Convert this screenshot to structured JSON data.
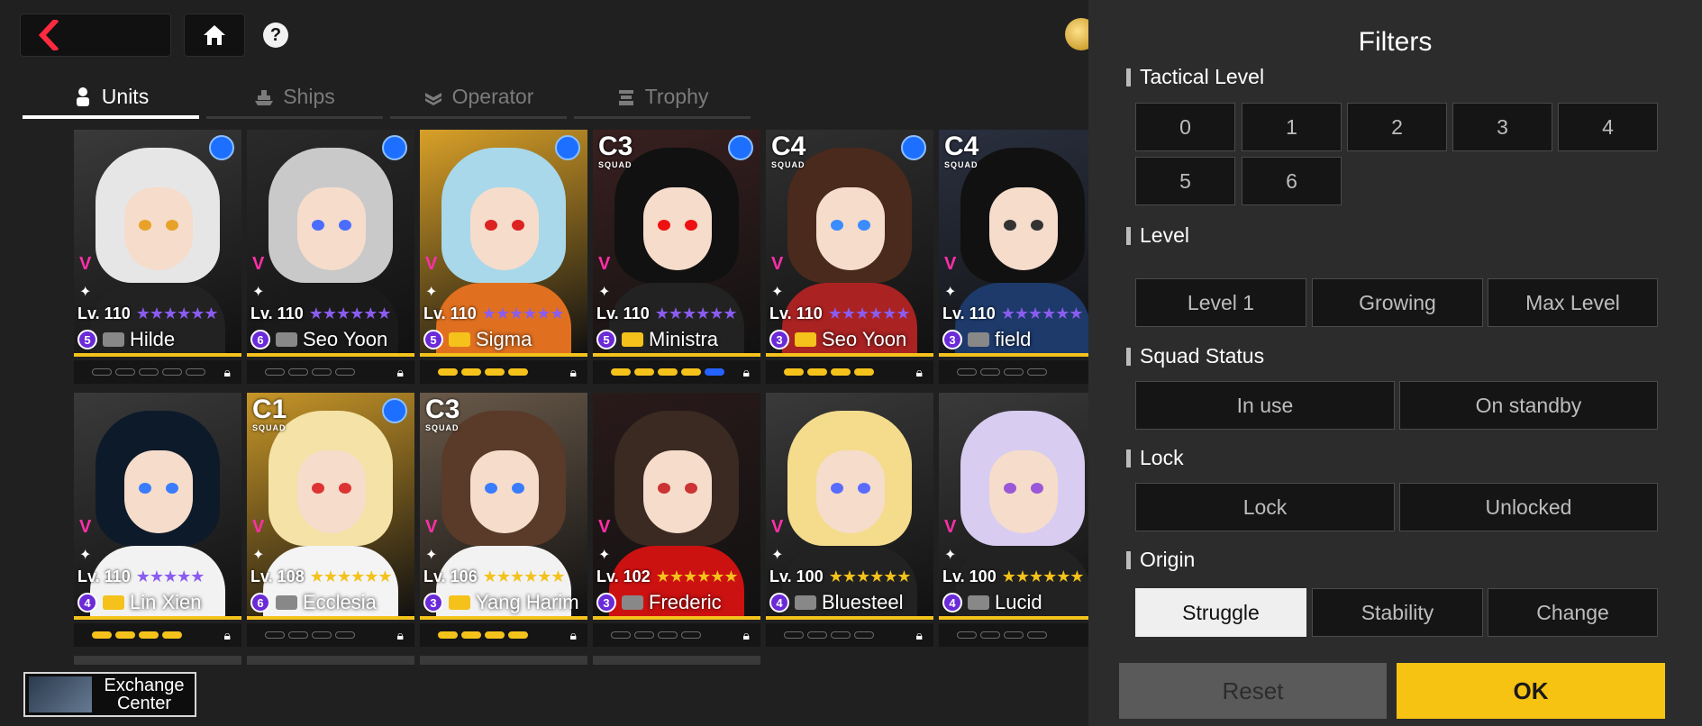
{
  "nav": {
    "back_icon": "back-arrow-icon",
    "home_icon": "home-icon",
    "help_label": "?"
  },
  "tabs": [
    {
      "label": "Units",
      "active": true,
      "icon": "person-icon"
    },
    {
      "label": "Ships",
      "active": false,
      "icon": "ship-icon"
    },
    {
      "label": "Operator",
      "active": false,
      "icon": "operator-icon"
    },
    {
      "label": "Trophy",
      "active": false,
      "icon": "trophy-icon"
    }
  ],
  "units": [
    {
      "name": "Hilde",
      "level": "Lv. 110",
      "rank": "5",
      "class": "",
      "squad": "",
      "stars": "★★★★★★",
      "pips": [
        0,
        0,
        0,
        0,
        0
      ],
      "hair": "#e6e6e6",
      "eyes": "#e8a22a",
      "outfit": "#222",
      "bg": "#3a3a3a"
    },
    {
      "name": "Seo Yoon",
      "level": "Lv. 110",
      "rank": "6",
      "class": "",
      "squad": "",
      "stars": "★★★★★★",
      "pips": [
        0,
        0,
        0,
        0
      ],
      "hair": "#c9c9c9",
      "eyes": "#4a6cff",
      "outfit": "#1a1a1a",
      "bg": "#2a2a2a"
    },
    {
      "name": "Sigma",
      "level": "Lv. 110",
      "rank": "5",
      "class": "",
      "squad": "",
      "stars": "★★★★★★",
      "pips": [
        1,
        1,
        1,
        1
      ],
      "hair": "#a8d8ea",
      "eyes": "#d22",
      "outfit": "#e07020",
      "bg": "#d8a028"
    },
    {
      "name": "Ministra",
      "level": "Lv. 110",
      "rank": "5",
      "class": "C3",
      "squad": "SQUAD",
      "stars": "★★★★★★",
      "pips": [
        1,
        1,
        1,
        1,
        2
      ],
      "hair": "#111",
      "eyes": "#e11",
      "outfit": "#222",
      "bg": "#3a2020"
    },
    {
      "name": "Seo Yoon",
      "level": "Lv. 110",
      "rank": "3",
      "class": "C4",
      "squad": "SQUAD",
      "stars": "★★★★★★",
      "pips": [
        1,
        1,
        1,
        1
      ],
      "hair": "#4a2a1c",
      "eyes": "#3a8cff",
      "outfit": "#a22",
      "bg": "#303030"
    },
    {
      "name": "field",
      "level": "Lv. 110",
      "rank": "3",
      "class": "C4",
      "squad": "SQUAD",
      "stars": "★★★★★★",
      "pips": [
        0,
        0,
        0,
        0
      ],
      "hair": "#111",
      "eyes": "#333",
      "outfit": "#1d3a6a",
      "bg": "#2a3040"
    },
    {
      "name": "Lin Xien",
      "level": "Lv. 110",
      "rank": "4",
      "class": "",
      "squad": "",
      "stars": "★★★★★",
      "pips": [
        1,
        1,
        1,
        1
      ],
      "hair": "#0d1a2a",
      "eyes": "#3a7cff",
      "outfit": "#f2f2f2",
      "bg": "#3a3a3a"
    },
    {
      "name": "Ecclesia",
      "level": "Lv. 108",
      "rank": "6",
      "class": "C1",
      "squad": "SQUAD",
      "stars": "★★★★★★",
      "pips": [
        0,
        0,
        0,
        0
      ],
      "hair": "#f4e2a6",
      "eyes": "#d33",
      "outfit": "#f4f4f4",
      "bg": "#c89628"
    },
    {
      "name": "Yang Harim",
      "level": "Lv. 106",
      "rank": "3",
      "class": "C3",
      "squad": "SQUAD",
      "stars": "★★★★★★",
      "pips": [
        1,
        1,
        1,
        1
      ],
      "hair": "#5a3a28",
      "eyes": "#3a7cff",
      "outfit": "#f2f2f2",
      "bg": "#6a5a4a"
    },
    {
      "name": "Frederic",
      "level": "Lv. 102",
      "rank": "3",
      "class": "",
      "squad": "",
      "stars": "★★★★★★",
      "pips": [
        0,
        0,
        0,
        0
      ],
      "hair": "#3a2a22",
      "eyes": "#c33",
      "outfit": "#c11",
      "bg": "#2a1a1a"
    },
    {
      "name": "Bluesteel",
      "level": "Lv. 100",
      "rank": "4",
      "class": "",
      "squad": "",
      "stars": "★★★★★★",
      "pips": [
        0,
        0,
        0,
        0
      ],
      "hair": "#f4dc8c",
      "eyes": "#5a6cff",
      "outfit": "#222",
      "bg": "#3a3a3a"
    },
    {
      "name": "Lucid",
      "level": "Lv. 100",
      "rank": "4",
      "class": "",
      "squad": "",
      "stars": "★★★★★★",
      "pips": [
        0,
        0,
        0,
        0
      ],
      "hair": "#d8ccf0",
      "eyes": "#9a58d8",
      "outfit": "#222",
      "bg": "#3a3a3a"
    }
  ],
  "exchange": {
    "label": "Exchange Center"
  },
  "filters": {
    "title": "Filters",
    "tactical_level": {
      "label": "Tactical Level",
      "options": [
        "0",
        "1",
        "2",
        "3",
        "4",
        "5",
        "6"
      ]
    },
    "level": {
      "label": "Level",
      "options": [
        "Level 1",
        "Growing",
        "Max Level"
      ]
    },
    "squad_status": {
      "label": "Squad Status",
      "options": [
        "In use",
        "On standby"
      ]
    },
    "lock": {
      "label": "Lock",
      "options": [
        "Lock",
        "Unlocked"
      ]
    },
    "origin": {
      "label": "Origin",
      "options": [
        "Struggle",
        "Stability",
        "Change"
      ],
      "selected": "Struggle"
    },
    "reset_label": "Reset",
    "ok_label": "OK"
  },
  "colors": {
    "accent": "#f6c313",
    "rank_purple": "#6b2ad8",
    "star_purple": "#8a5cf0",
    "star_gold": "#f4c21b"
  }
}
